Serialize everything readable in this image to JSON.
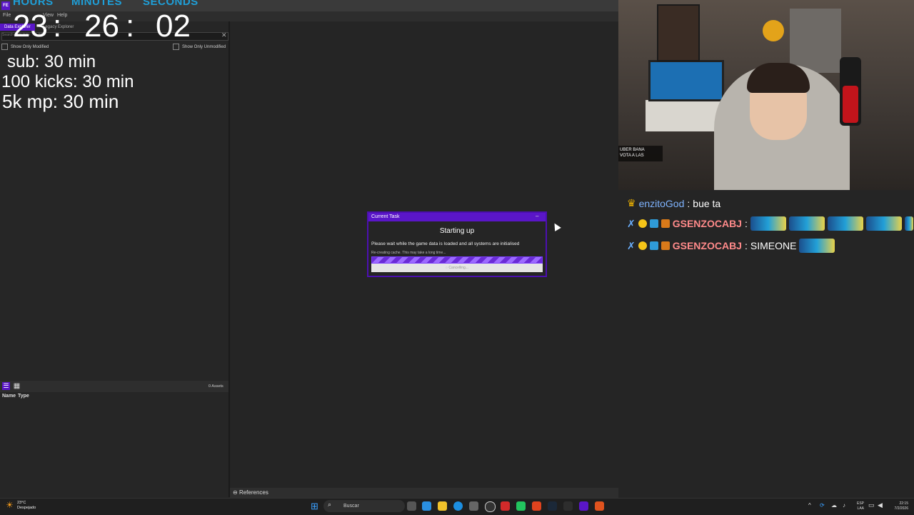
{
  "app": {
    "logo_text": "FE",
    "faded_title": "Data Explorer"
  },
  "menu": {
    "file": "File",
    "view": "View",
    "help": "Help"
  },
  "tabs": {
    "data_explorer": "Data Explorer",
    "legacy_explorer": "Legacy Explorer"
  },
  "search": {
    "placeholder": "Search data, type ':' to filter"
  },
  "filters": {
    "only_modified": "Show Only Modified",
    "only_unmodified": "Show Only Unmodified"
  },
  "timer": {
    "hours_label": "HOURS",
    "minutes_label": "MINUTES",
    "seconds_label": "SECONDS",
    "hours": "23",
    "minutes": "26",
    "seconds": "02",
    "separator": ":"
  },
  "rules": [
    "sub: 30 min",
    "100 kicks: 30 min",
    "5k mp: 30 min"
  ],
  "assets": {
    "count_label": "0 Assets",
    "col_name": "Name",
    "col_type": "Type"
  },
  "references": {
    "label": "References"
  },
  "dialog": {
    "title": "Current Task",
    "heading": "Starting up",
    "message": "Please wait while the game data is loaded and all systems are initialised",
    "sub_message": "Re-creating cache. This may take a long time...",
    "cancel_label": "Cancelling..."
  },
  "webcam_overlay": {
    "line1": "UBER BANA",
    "line2": "VOTA A LAS"
  },
  "chat": [
    {
      "user": "enzitoGod",
      "text": "bue ta",
      "user_color": "#7fb4ff"
    },
    {
      "user": "GSENZOCABJ",
      "text": "",
      "user_color": "#ff8a8a"
    },
    {
      "user": "GSENZOCABJ",
      "text": "SIMEONE",
      "user_color": "#ff8a8a"
    }
  ],
  "taskbar": {
    "weather_temp": "23°C",
    "weather_text": "Despejado",
    "search_label": "Buscar",
    "lang_top": "ESP",
    "lang_bottom": "LAA",
    "time": "22:15",
    "date": "7/2/2026"
  },
  "colors": {
    "accent": "#5a16c8",
    "timer_label": "#1f9fd8"
  }
}
